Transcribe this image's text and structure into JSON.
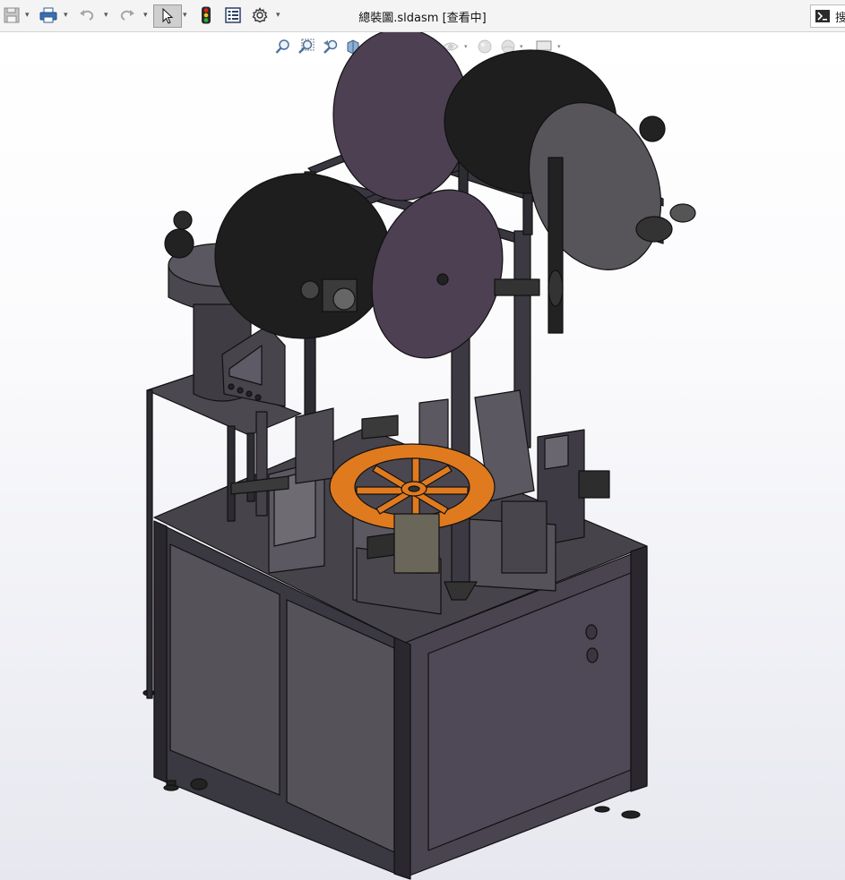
{
  "window": {
    "title": "總裝圖.sldasm [查看中]"
  },
  "toolbar": {
    "items": [
      {
        "name": "save",
        "icon": "save-icon"
      },
      {
        "name": "print",
        "icon": "print-icon"
      },
      {
        "name": "undo",
        "icon": "undo-icon"
      },
      {
        "name": "redo",
        "icon": "redo-icon"
      },
      {
        "name": "select",
        "icon": "select-cursor-icon",
        "active": true
      },
      {
        "name": "rebuild",
        "icon": "traffic-light-icon"
      },
      {
        "name": "file-properties",
        "icon": "file-properties-icon"
      },
      {
        "name": "options",
        "icon": "gear-icon"
      }
    ]
  },
  "search": {
    "label": "搜"
  },
  "heads_up_toolbar": {
    "items": [
      "zoom-to-fit-icon",
      "zoom-to-area-icon",
      "previous-view-icon",
      "section-view-icon",
      "view-orientation-icon",
      "display-style-icon",
      "hide-show-items-icon",
      "edit-appearance-icon",
      "apply-scene-icon",
      "view-settings-icon"
    ]
  },
  "model": {
    "name": "assembly-machine",
    "colors": {
      "frame": "#3f3c44",
      "panel": "#4a4750",
      "panel_dark": "#2f2d33",
      "reel_black": "#1e1e1f",
      "reel_purple": "#4d4052",
      "reel_gray": "#57555a",
      "rotary_table": "#e07a1f",
      "edge": "#111111"
    }
  }
}
